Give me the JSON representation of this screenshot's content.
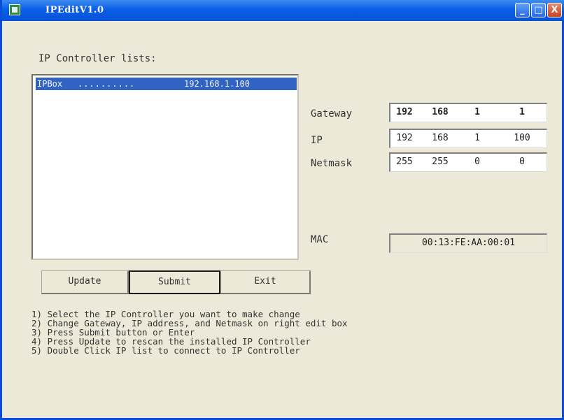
{
  "window": {
    "title": "IPEditV1.0",
    "controls": {
      "minimize": "_",
      "maximize": "□",
      "close": "X"
    }
  },
  "list_panel": {
    "title": "IP Controller lists:",
    "items": [
      {
        "name": "IPBox",
        "dots": "..........",
        "address": "192.168.1.100",
        "selected": true
      }
    ]
  },
  "fields": {
    "gateway": {
      "label": "Gateway",
      "octets": [
        "192",
        "168",
        "1",
        "1"
      ]
    },
    "ip": {
      "label": "IP",
      "octets": [
        "192",
        "168",
        "1",
        "100"
      ]
    },
    "netmask": {
      "label": "Netmask",
      "octets": [
        "255",
        "255",
        "0",
        "0"
      ]
    },
    "mac": {
      "label": "MAC",
      "value": "00:13:FE:AA:00:01"
    }
  },
  "buttons": {
    "update": "Update",
    "submit": "Submit",
    "exit": "Exit"
  },
  "instructions": [
    "1) Select the IP Controller you want to make change",
    "2) Change Gateway, IP address, and Netmask on right edit box",
    "3) Press Submit button or Enter",
    "4) Press Update to rescan the installed IP Controller",
    "5) Double Click IP list to connect to IP Controller"
  ],
  "colors": {
    "titlebar": "#0b5ee6",
    "selection": "#3163c4",
    "window_bg": "#ece9d8"
  }
}
